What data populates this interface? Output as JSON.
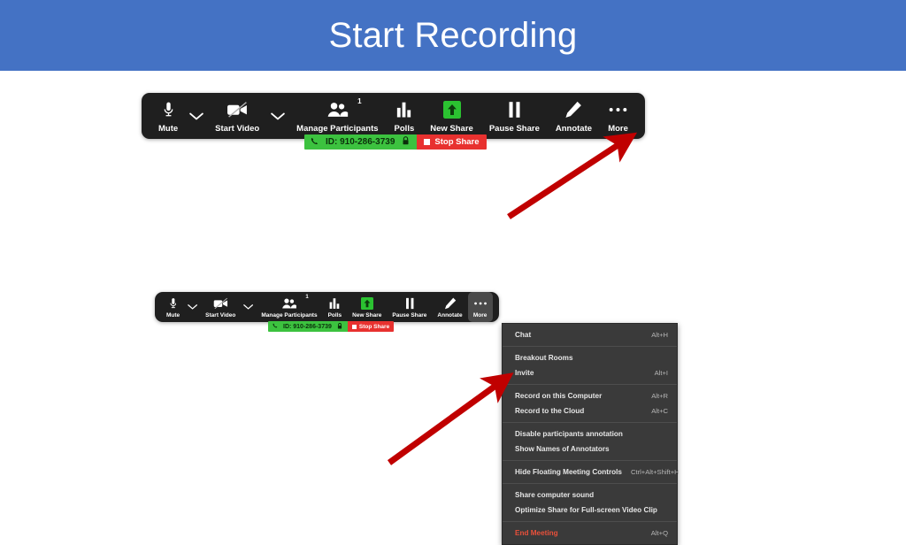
{
  "slide": {
    "title": "Start Recording",
    "banner_color": "#4472C4",
    "background_color": "#FFFFFF",
    "arrow_color": "#C00000"
  },
  "toolbar": {
    "items": [
      {
        "label": "Mute",
        "icon": "microphone-icon",
        "caret": true,
        "badge": null
      },
      {
        "label": "Start Video",
        "icon": "video-camera-off-icon",
        "caret": true,
        "badge": null
      },
      {
        "label": "Manage Participants",
        "icon": "participants-icon",
        "caret": false,
        "badge": "1"
      },
      {
        "label": "Polls",
        "icon": "bar-chart-icon",
        "caret": false,
        "badge": null
      },
      {
        "label": "New Share",
        "icon": "share-up-arrow-icon",
        "caret": false,
        "badge": null
      },
      {
        "label": "Pause Share",
        "icon": "pause-icon",
        "caret": false,
        "badge": null
      },
      {
        "label": "Annotate",
        "icon": "pencil-icon",
        "caret": false,
        "badge": null
      },
      {
        "label": "More",
        "icon": "ellipsis-icon",
        "caret": false,
        "badge": null
      }
    ]
  },
  "share_bar": {
    "phone_icon": "phone-icon",
    "meeting_id": "ID: 910-286-3739",
    "lock_icon": "lock-icon",
    "stop_share_label": "Stop Share",
    "green_color": "#3CC23F",
    "red_color": "#E8312F"
  },
  "more_menu": {
    "groups": [
      {
        "items": [
          {
            "label": "Chat",
            "shortcut": "Alt+H",
            "danger": false
          }
        ]
      },
      {
        "items": [
          {
            "label": "Breakout Rooms",
            "shortcut": "",
            "danger": false
          },
          {
            "label": "Invite",
            "shortcut": "Alt+I",
            "danger": false
          }
        ]
      },
      {
        "items": [
          {
            "label": "Record on this Computer",
            "shortcut": "Alt+R",
            "danger": false
          },
          {
            "label": "Record to the Cloud",
            "shortcut": "Alt+C",
            "danger": false
          }
        ]
      },
      {
        "items": [
          {
            "label": "Disable participants annotation",
            "shortcut": "",
            "danger": false
          },
          {
            "label": "Show Names of Annotators",
            "shortcut": "",
            "danger": false
          }
        ]
      },
      {
        "items": [
          {
            "label": "Hide Floating Meeting Controls",
            "shortcut": "Ctrl+Alt+Shift+H",
            "danger": false
          }
        ]
      },
      {
        "items": [
          {
            "label": "Share computer sound",
            "shortcut": "",
            "danger": false
          },
          {
            "label": "Optimize Share for Full-screen Video Clip",
            "shortcut": "",
            "danger": false
          }
        ]
      },
      {
        "items": [
          {
            "label": "End Meeting",
            "shortcut": "Alt+Q",
            "danger": true
          }
        ]
      }
    ]
  },
  "annotations": {
    "arrow_top": {
      "name": "arrow-pointing-to-more-button"
    },
    "arrow_bottom": {
      "name": "arrow-pointing-to-record-on-this-computer"
    }
  }
}
